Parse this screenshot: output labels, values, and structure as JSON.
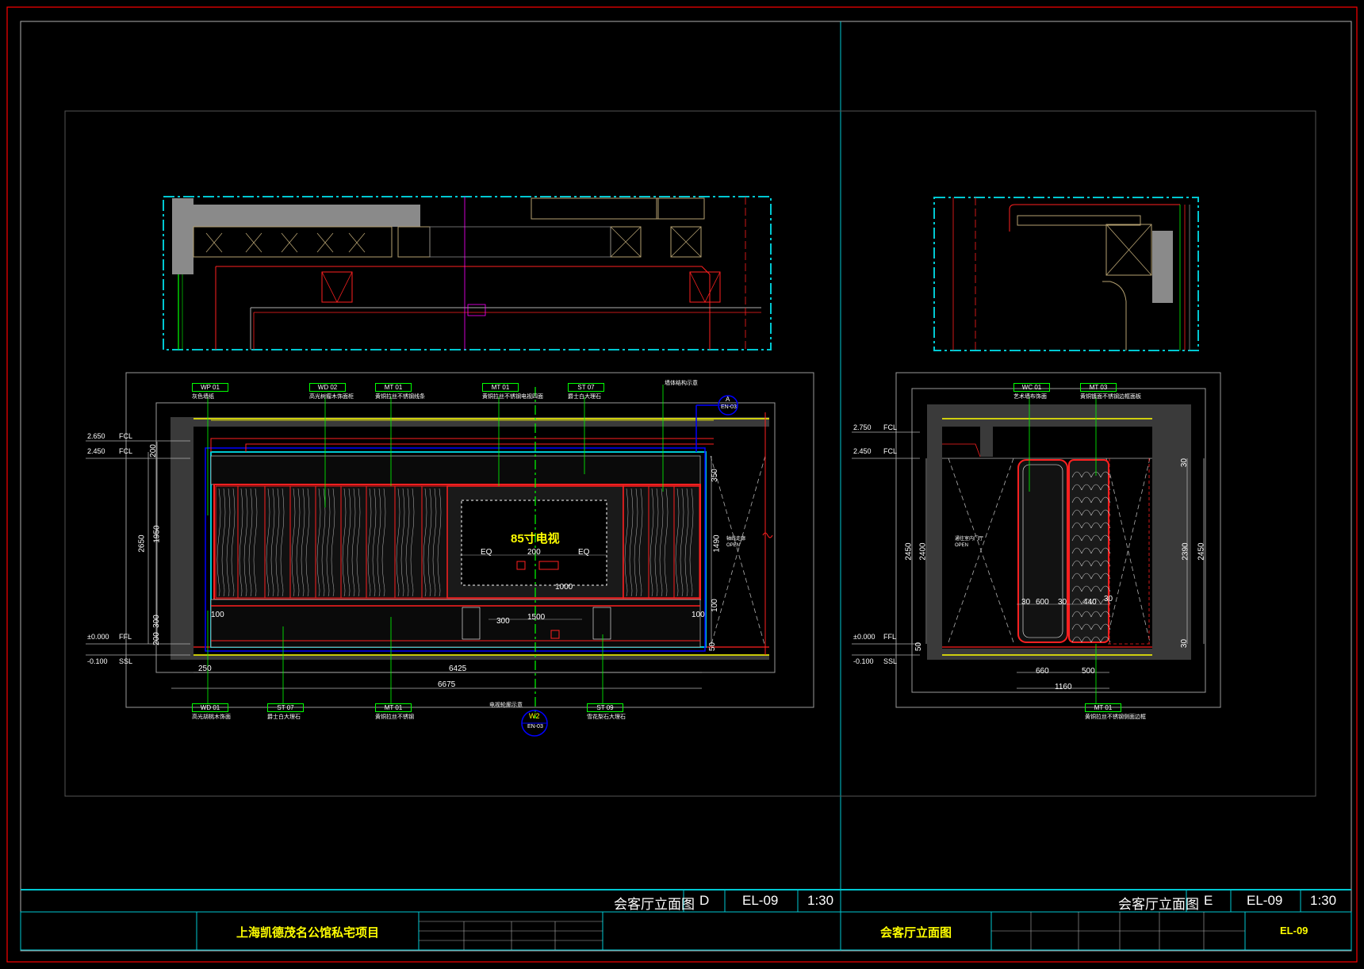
{
  "elevation_d": {
    "tv_label": "85寸电视",
    "eq_left": "EQ",
    "eq_right": "EQ",
    "tv_gap": "200",
    "tags_top": [
      {
        "code": "WP 01",
        "desc": "灰色墙纸"
      },
      {
        "code": "WD 02",
        "desc": "高光树瘤木饰面柜"
      },
      {
        "code": "MT 01",
        "desc": "黄铜拉丝不锈钢线条"
      },
      {
        "code": "MT 01",
        "desc": "黄铜拉丝不锈钢电视四面"
      },
      {
        "code": "ST 07",
        "desc": "爵士白大理石"
      }
    ],
    "note_top_right": "墙体结构示意",
    "tags_bottom": [
      {
        "code": "WD 01",
        "desc": "高光胡桃木饰面"
      },
      {
        "code": "ST 07",
        "desc": "爵士白大理石"
      },
      {
        "code": "MT 01",
        "desc": "黄铜拉丝不锈钢"
      },
      {
        "code": "ST 09",
        "desc": "雪花梨石大理石"
      }
    ],
    "note_bottom_center": "电视轮廓示意",
    "section_marker": {
      "letter": "A",
      "ref": "EN-03"
    },
    "center_marker": {
      "letter": "W2",
      "ref": "EN-03"
    },
    "open_label": "轴线走廊\nOPEN",
    "levels": [
      {
        "value": "2.650",
        "tag": "FCL"
      },
      {
        "value": "2.450",
        "tag": "FCL"
      },
      {
        "value": "±0.000",
        "tag": "FFL"
      },
      {
        "value": "-0.100",
        "tag": "SSL"
      }
    ],
    "dims_left": [
      "200",
      "2650",
      "1950",
      "300",
      "200"
    ],
    "dims_right": [
      "350",
      "1490",
      "100",
      "50"
    ],
    "dims_inner": [
      "100",
      "100",
      "300",
      "1500",
      "1000"
    ],
    "dims_bottom": [
      "250",
      "6425",
      "6675"
    ]
  },
  "elevation_e": {
    "tags_top": [
      {
        "code": "WC 01",
        "desc": "艺术墙布饰面"
      },
      {
        "code": "MT 03",
        "desc": "黄铜镀面不锈钢边框面板"
      }
    ],
    "tags_bottom": [
      {
        "code": "MT 01",
        "desc": "黄铜拉丝不锈钢侧面边框"
      }
    ],
    "open_label": "通往室内门厅\nOPEN",
    "levels": [
      {
        "value": "2.750",
        "tag": "FCL"
      },
      {
        "value": "2.450",
        "tag": "FCL"
      },
      {
        "value": "±0.000",
        "tag": "FFL"
      },
      {
        "value": "-0.100",
        "tag": "SSL"
      }
    ],
    "dims_left": [
      "2450",
      "2400",
      "50"
    ],
    "dims_right": [
      "30",
      "2390",
      "2450",
      "30"
    ],
    "dims_inner": [
      "30",
      "600",
      "30",
      "440",
      "30"
    ],
    "dims_bottom": [
      "660",
      "500",
      "1160"
    ]
  },
  "titlebar_d": {
    "title": "会客厅立面图",
    "letter": "D",
    "sheet": "EL-09",
    "scale": "1:30"
  },
  "titlebar_e": {
    "title": "会客厅立面图",
    "letter": "E",
    "sheet": "EL-09",
    "scale": "1:30"
  },
  "titleblock": {
    "project_name": "上海凯德茂名公馆私宅项目",
    "drawing_title": "会客厅立面图",
    "sheet_no": "EL-09"
  },
  "colors": {
    "background": "#000000",
    "frame_red": "#ff0000",
    "cyan": "#00c8d2",
    "yellow": "#ffff00",
    "green": "#00ff00",
    "magenta": "#ff00ff",
    "blue": "#0000ff",
    "grey": "#808080",
    "dark_grey": "#3a3a3a"
  }
}
